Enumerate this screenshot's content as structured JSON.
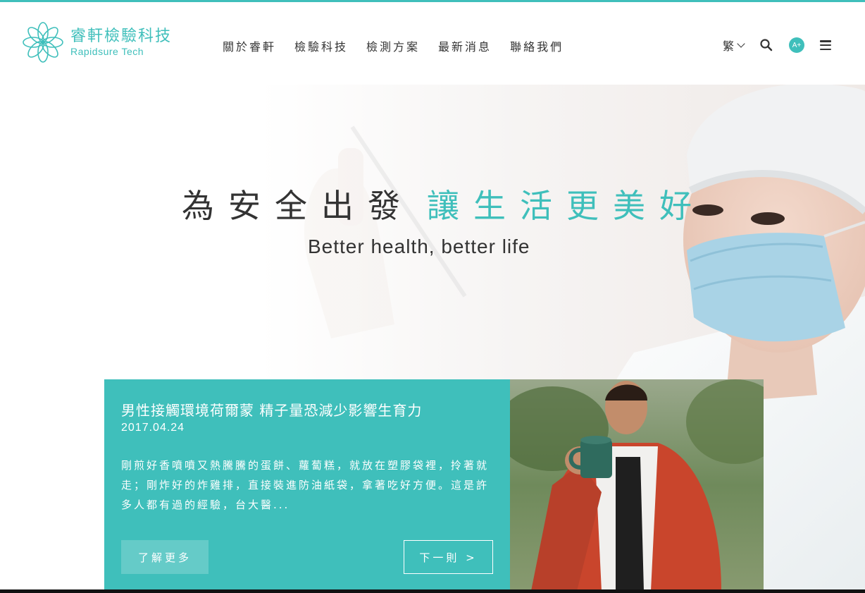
{
  "brand": {
    "name_cn": "睿軒檢驗科技",
    "name_en": "Rapidsure Tech",
    "accent_color": "#3fbfbb"
  },
  "nav": {
    "items": [
      {
        "label": "關於睿軒"
      },
      {
        "label": "檢驗科技"
      },
      {
        "label": "檢測方案"
      },
      {
        "label": "最新消息"
      },
      {
        "label": "聯絡我們"
      }
    ]
  },
  "tools": {
    "language_label": "繁",
    "font_size_label": "A+",
    "search_icon": "search-icon",
    "menu_icon": "hamburger-menu-icon"
  },
  "hero": {
    "title_dark": "為安全出發",
    "title_teal": "讓生活更美好",
    "subtitle": "Better health, better life"
  },
  "news": {
    "title": "男性接觸環境荷爾蒙 精子量恐減少影響生育力",
    "date": "2017.04.24",
    "excerpt": "剛煎好香噴噴又熱騰騰的蛋餅、蘿蔔糕，就放在塑膠袋裡，拎著就走；剛炸好的炸雞排，直接裝進防油紙袋，拿著吃好方便。這是許多人都有過的經驗，台大醫...",
    "more_label": "了解更多",
    "next_label": "下一則 >"
  }
}
